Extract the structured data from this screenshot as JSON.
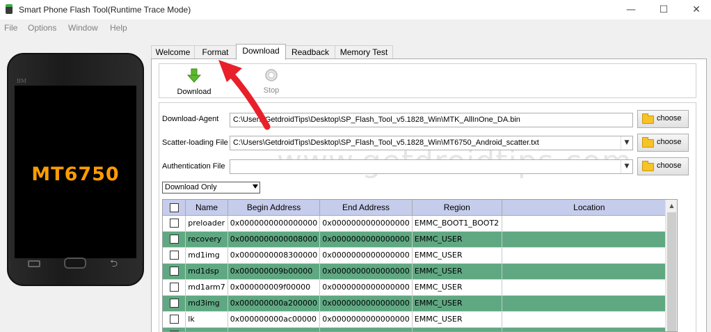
{
  "window": {
    "title": "Smart Phone Flash Tool(Runtime Trace Mode)",
    "minimize": "—",
    "maximize": "☐",
    "close": "✕"
  },
  "menu": [
    "File",
    "Options",
    "Window",
    "Help"
  ],
  "phone": {
    "brand": "BM",
    "model": "MT6750",
    "back_glyph": "⮌"
  },
  "tabs": [
    {
      "label": "Welcome",
      "active": false
    },
    {
      "label": "Format",
      "active": false
    },
    {
      "label": "Download",
      "active": true
    },
    {
      "label": "Readback",
      "active": false
    },
    {
      "label": "Memory Test",
      "active": false
    }
  ],
  "toolbar": {
    "download_label": "Download",
    "stop_label": "Stop"
  },
  "fields": {
    "download_agent": {
      "label": "Download-Agent",
      "value": "C:\\Users\\GetdroidTips\\Desktop\\SP_Flash_Tool_v5.1828_Win\\MTK_AllInOne_DA.bin",
      "button": "choose"
    },
    "scatter": {
      "label": "Scatter-loading File",
      "value": "C:\\Users\\GetdroidTips\\Desktop\\SP_Flash_Tool_v5.1828_Win\\MT6750_Android_scatter.txt",
      "button": "choose"
    },
    "auth": {
      "label": "Authentication File",
      "value": "",
      "button": "choose"
    }
  },
  "mode": "Download Only",
  "table": {
    "headers": [
      "Name",
      "Begin Address",
      "End Address",
      "Region",
      "Location"
    ],
    "rows": [
      {
        "name": "preloader",
        "begin": "0x0000000000000000",
        "end": "0x0000000000000000",
        "region": "EMMC_BOOT1_BOOT2",
        "location": "",
        "highlight": false
      },
      {
        "name": "recovery",
        "begin": "0x0000000000008000",
        "end": "0x0000000000000000",
        "region": "EMMC_USER",
        "location": "",
        "highlight": true
      },
      {
        "name": "md1img",
        "begin": "0x0000000008300000",
        "end": "0x0000000000000000",
        "region": "EMMC_USER",
        "location": "",
        "highlight": false
      },
      {
        "name": "md1dsp",
        "begin": "0x000000009b00000",
        "end": "0x0000000000000000",
        "region": "EMMC_USER",
        "location": "",
        "highlight": true
      },
      {
        "name": "md1arm7",
        "begin": "0x000000009f00000",
        "end": "0x0000000000000000",
        "region": "EMMC_USER",
        "location": "",
        "highlight": false
      },
      {
        "name": "md3img",
        "begin": "0x000000000a200000",
        "end": "0x0000000000000000",
        "region": "EMMC_USER",
        "location": "",
        "highlight": true
      },
      {
        "name": "lk",
        "begin": "0x000000000ac00000",
        "end": "0x0000000000000000",
        "region": "EMMC_USER",
        "location": "",
        "highlight": false
      },
      {
        "name": "",
        "begin": "",
        "end": "",
        "region": "",
        "location": "",
        "highlight": true
      }
    ]
  },
  "watermark": "www.getdroidtips.com",
  "colors": {
    "highlight_row": "#5fa882",
    "header_bg": "#c6cceb",
    "model_text": "#ff9c00",
    "annotation_arrow": "#e8202a"
  }
}
